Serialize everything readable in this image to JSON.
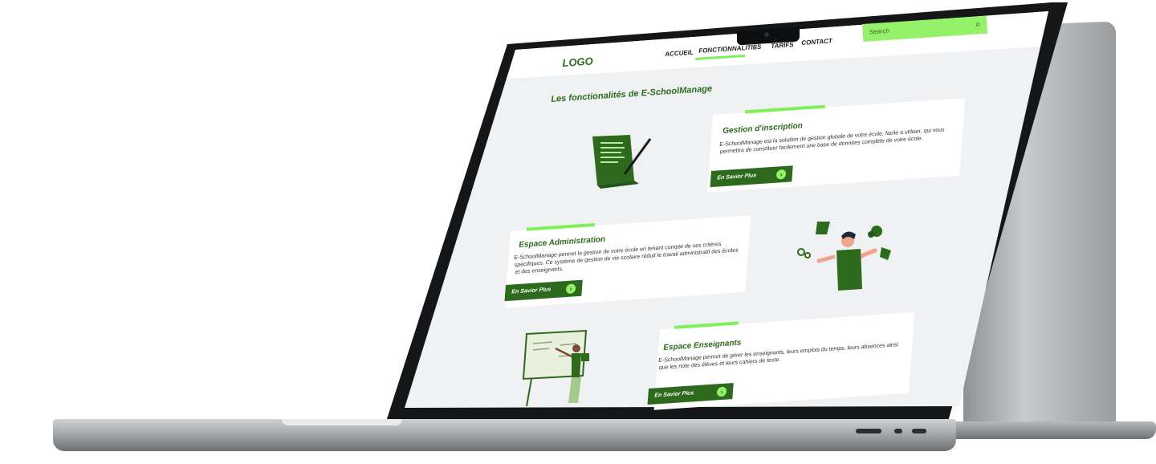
{
  "nav": {
    "logo": "LOGO",
    "links": [
      "ACCUEIL",
      "FONCTIONNALITIES",
      "TARIFS",
      "CONTACT"
    ],
    "search_placeholder": "Search"
  },
  "main": {
    "section_title": "Les fonctionalités de E-SchoolManage",
    "cards": [
      {
        "title": "Gestion d'inscription",
        "description": "E-SchoolManage est la solution de gestion globale de votre école, facile a utiliser, qui vous permettra de constituer facilement une base de données complète de votre école.",
        "button": "En Savior Plus"
      },
      {
        "title": "Espace Administration",
        "description": "E-SchoolManage permet la gestion de votre école en tenant compte de ses critères spécifiques. Ce système de gestion de vie scolaire réduit le travail administratif des écoles et des enseignants.",
        "button": "En Savior Plus"
      },
      {
        "title": "Espace Enseignants",
        "description": "E-SchoolManage permet de gérer les enseignants, leurs emplois du temps, leurs absences ainsi que les note des élèves et leurs cahiers de texte.",
        "button": "En Savior Plus"
      }
    ]
  },
  "colors": {
    "brand_green": "#2e6a1e",
    "accent_green": "#7df05a",
    "screen_bg": "#f0f1f3"
  }
}
